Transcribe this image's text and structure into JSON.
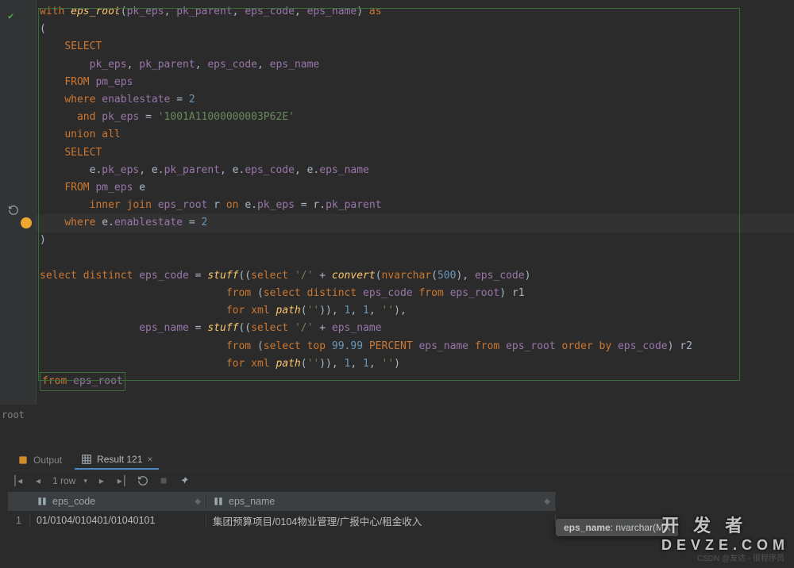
{
  "editor": {
    "lines": [
      {
        "t": [
          [
            "kw",
            "with"
          ],
          [
            "pl",
            " "
          ],
          [
            "fn",
            "eps_root"
          ],
          [
            "pl",
            "("
          ],
          [
            "id",
            "pk_eps"
          ],
          [
            "pl",
            ", "
          ],
          [
            "id",
            "pk_parent"
          ],
          [
            "pl",
            ", "
          ],
          [
            "id",
            "eps_code"
          ],
          [
            "pl",
            ", "
          ],
          [
            "id",
            "eps_name"
          ],
          [
            "pl",
            ") "
          ],
          [
            "kw",
            "as"
          ]
        ]
      },
      {
        "t": [
          [
            "pl",
            "("
          ]
        ]
      },
      {
        "t": [
          [
            "pl",
            "    "
          ],
          [
            "kw",
            "SELECT"
          ]
        ]
      },
      {
        "t": [
          [
            "pl",
            "        "
          ],
          [
            "id",
            "pk_eps"
          ],
          [
            "pl",
            ", "
          ],
          [
            "id",
            "pk_parent"
          ],
          [
            "pl",
            ", "
          ],
          [
            "id",
            "eps_code"
          ],
          [
            "pl",
            ", "
          ],
          [
            "id",
            "eps_name"
          ]
        ]
      },
      {
        "t": [
          [
            "pl",
            "    "
          ],
          [
            "kw",
            "FROM"
          ],
          [
            "pl",
            " "
          ],
          [
            "id",
            "pm_eps"
          ]
        ]
      },
      {
        "t": [
          [
            "pl",
            "    "
          ],
          [
            "kw",
            "where"
          ],
          [
            "pl",
            " "
          ],
          [
            "id",
            "enablestate"
          ],
          [
            "pl",
            " = "
          ],
          [
            "num",
            "2"
          ]
        ]
      },
      {
        "t": [
          [
            "pl",
            "      "
          ],
          [
            "kw",
            "and"
          ],
          [
            "pl",
            " "
          ],
          [
            "id",
            "pk_eps"
          ],
          [
            "pl",
            " = "
          ],
          [
            "str",
            "'1001A11000000003P62E'"
          ]
        ]
      },
      {
        "t": [
          [
            "pl",
            "    "
          ],
          [
            "kw",
            "union all"
          ]
        ]
      },
      {
        "t": [
          [
            "pl",
            "    "
          ],
          [
            "kw",
            "SELECT"
          ]
        ]
      },
      {
        "t": [
          [
            "pl",
            "        e."
          ],
          [
            "id",
            "pk_eps"
          ],
          [
            "pl",
            ", e."
          ],
          [
            "id",
            "pk_parent"
          ],
          [
            "pl",
            ", e."
          ],
          [
            "id",
            "eps_code"
          ],
          [
            "pl",
            ", e."
          ],
          [
            "id",
            "eps_name"
          ]
        ]
      },
      {
        "t": [
          [
            "pl",
            "    "
          ],
          [
            "kw",
            "FROM"
          ],
          [
            "pl",
            " "
          ],
          [
            "id",
            "pm_eps"
          ],
          [
            "pl",
            " e"
          ]
        ]
      },
      {
        "t": [
          [
            "pl",
            "        "
          ],
          [
            "kw",
            "inner join"
          ],
          [
            "pl",
            " "
          ],
          [
            "id",
            "eps_root"
          ],
          [
            "pl",
            " r "
          ],
          [
            "kw",
            "on"
          ],
          [
            "pl",
            " e."
          ],
          [
            "id",
            "pk_eps"
          ],
          [
            "pl",
            " = r."
          ],
          [
            "id",
            "pk_parent"
          ]
        ]
      },
      {
        "t": [
          [
            "pl",
            "    "
          ],
          [
            "kw",
            "where"
          ],
          [
            "pl",
            " e."
          ],
          [
            "id",
            "enablestate"
          ],
          [
            "pl",
            " = "
          ],
          [
            "num",
            "2"
          ]
        ],
        "hl": true,
        "bulb": true
      },
      {
        "t": [
          [
            "pl",
            ")"
          ]
        ]
      },
      {
        "t": [
          [
            "pl",
            " "
          ]
        ]
      },
      {
        "t": [
          [
            "kw",
            "select distinct"
          ],
          [
            "pl",
            " "
          ],
          [
            "id",
            "eps_code"
          ],
          [
            "pl",
            " = "
          ],
          [
            "fn",
            "stuff"
          ],
          [
            "pl",
            "(("
          ],
          [
            "kw",
            "select"
          ],
          [
            "pl",
            " "
          ],
          [
            "str",
            "'/'"
          ],
          [
            "pl",
            " + "
          ],
          [
            "fn",
            "convert"
          ],
          [
            "pl",
            "("
          ],
          [
            "kw",
            "nvarchar"
          ],
          [
            "pl",
            "("
          ],
          [
            "num",
            "500"
          ],
          [
            "pl",
            "), "
          ],
          [
            "id",
            "eps_code"
          ],
          [
            "pl",
            ")"
          ]
        ]
      },
      {
        "t": [
          [
            "pl",
            "                              "
          ],
          [
            "kw",
            "from"
          ],
          [
            "pl",
            " ("
          ],
          [
            "kw",
            "select distinct"
          ],
          [
            "pl",
            " "
          ],
          [
            "id",
            "eps_code"
          ],
          [
            "pl",
            " "
          ],
          [
            "kw",
            "from"
          ],
          [
            "pl",
            " "
          ],
          [
            "id",
            "eps_root"
          ],
          [
            "pl",
            ") r1"
          ]
        ]
      },
      {
        "t": [
          [
            "pl",
            "                              "
          ],
          [
            "kw",
            "for"
          ],
          [
            "pl",
            " "
          ],
          [
            "kw",
            "xml"
          ],
          [
            "pl",
            " "
          ],
          [
            "fn",
            "path"
          ],
          [
            "pl",
            "("
          ],
          [
            "str",
            "''"
          ],
          [
            "pl",
            ")), "
          ],
          [
            "num",
            "1"
          ],
          [
            "pl",
            ", "
          ],
          [
            "num",
            "1"
          ],
          [
            "pl",
            ", "
          ],
          [
            "str",
            "''"
          ],
          [
            "pl",
            "),"
          ]
        ]
      },
      {
        "t": [
          [
            "pl",
            "                "
          ],
          [
            "id",
            "eps_name"
          ],
          [
            "pl",
            " = "
          ],
          [
            "fn",
            "stuff"
          ],
          [
            "pl",
            "(("
          ],
          [
            "kw",
            "select"
          ],
          [
            "pl",
            " "
          ],
          [
            "str",
            "'/'"
          ],
          [
            "pl",
            " + "
          ],
          [
            "id",
            "eps_name"
          ]
        ]
      },
      {
        "t": [
          [
            "pl",
            "                              "
          ],
          [
            "kw",
            "from"
          ],
          [
            "pl",
            " ("
          ],
          [
            "kw",
            "select"
          ],
          [
            "pl",
            " "
          ],
          [
            "kw",
            "top"
          ],
          [
            "pl",
            " "
          ],
          [
            "num",
            "99.99"
          ],
          [
            "pl",
            " "
          ],
          [
            "kw",
            "PERCENT"
          ],
          [
            "pl",
            " "
          ],
          [
            "id",
            "eps_name"
          ],
          [
            "pl",
            " "
          ],
          [
            "kw",
            "from"
          ],
          [
            "pl",
            " "
          ],
          [
            "id",
            "eps_root"
          ],
          [
            "pl",
            " "
          ],
          [
            "kw",
            "order by"
          ],
          [
            "pl",
            " "
          ],
          [
            "id",
            "eps_code"
          ],
          [
            "pl",
            ") r2"
          ]
        ]
      },
      {
        "t": [
          [
            "pl",
            "                              "
          ],
          [
            "kw",
            "for"
          ],
          [
            "pl",
            " "
          ],
          [
            "kw",
            "xml"
          ],
          [
            "pl",
            " "
          ],
          [
            "fn",
            "path"
          ],
          [
            "pl",
            "("
          ],
          [
            "str",
            "''"
          ],
          [
            "pl",
            ")), "
          ],
          [
            "num",
            "1"
          ],
          [
            "pl",
            ", "
          ],
          [
            "num",
            "1"
          ],
          [
            "pl",
            ", "
          ],
          [
            "str",
            "''"
          ],
          [
            "pl",
            ")"
          ]
        ]
      },
      {
        "t": [
          [
            "kw",
            "from"
          ],
          [
            "pl",
            " "
          ],
          [
            "id",
            "eps_root"
          ]
        ],
        "boxed": true
      }
    ],
    "tab_label": "root"
  },
  "panel": {
    "tabs": {
      "output": "Output",
      "result": "Result 121"
    },
    "toolbar": {
      "row_count": "1 row"
    },
    "columns": [
      "eps_code",
      "eps_name"
    ],
    "rows": [
      {
        "n": "1",
        "eps_code": "01/0104/010401/01040101",
        "eps_name": "   集团预算项目/0104物业管理/广报中心/租金收入"
      }
    ],
    "tooltip": {
      "label": "eps_name",
      "type": ": nvarchar(MA"
    }
  },
  "watermark": {
    "line1": "开 发 者",
    "line2": "DEVZE.COM"
  },
  "csdn": "CSDN @友达 - 很程序员"
}
